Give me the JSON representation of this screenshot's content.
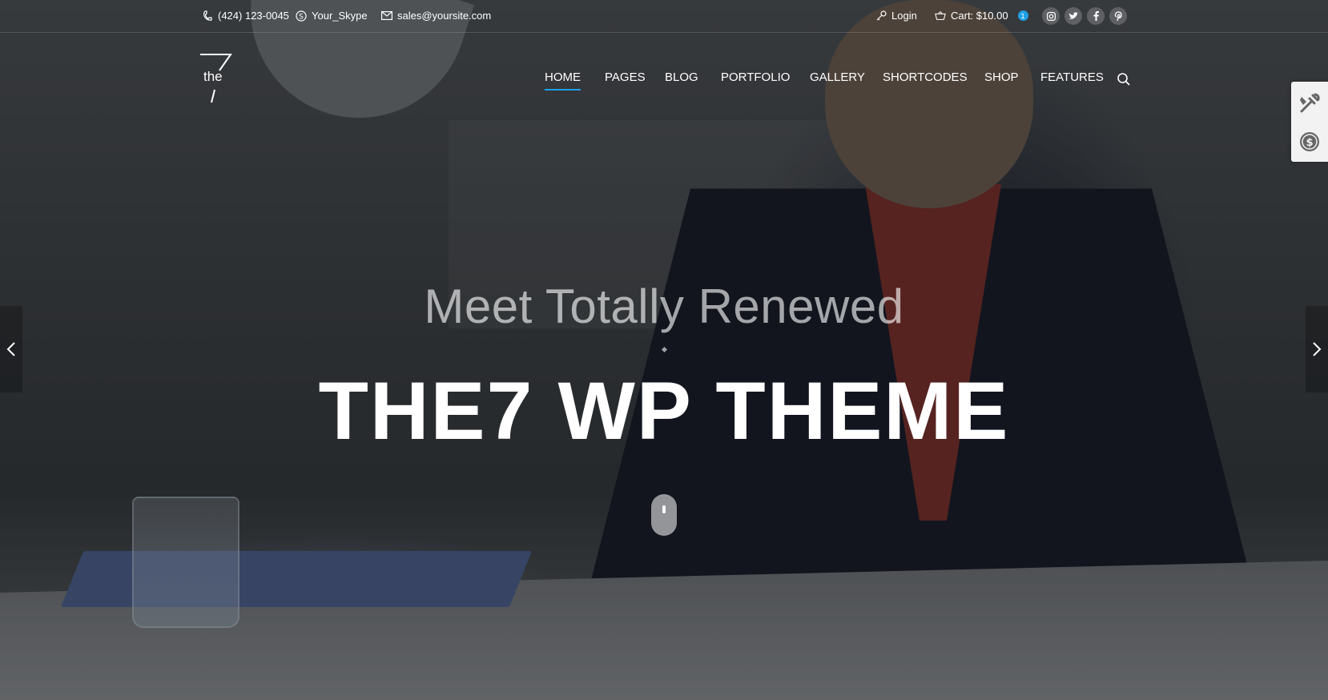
{
  "topbar": {
    "phone": "(424) 123-0045",
    "skype": "Your_Skype",
    "email": "sales@yoursite.com",
    "login": "Login",
    "cart": "Cart: $10.00",
    "cart_count": "1",
    "social": [
      "instagram-icon",
      "twitter-icon",
      "facebook-icon",
      "pinterest-icon"
    ]
  },
  "logo": {
    "mark": "7",
    "word": "the"
  },
  "nav": {
    "items": [
      {
        "label": "HOME",
        "active": true
      },
      {
        "label": "PAGES"
      },
      {
        "label": "BLOG"
      },
      {
        "label": "PORTFOLIO"
      },
      {
        "label": "GALLERY"
      },
      {
        "label": "SHORTCODES"
      },
      {
        "label": "SHOP"
      },
      {
        "label": "FEATURES"
      }
    ]
  },
  "hero": {
    "subtitle": "Meet Totally Renewed",
    "title": "THE7 WP THEME"
  },
  "colors": {
    "accent": "#1ea0e6"
  }
}
